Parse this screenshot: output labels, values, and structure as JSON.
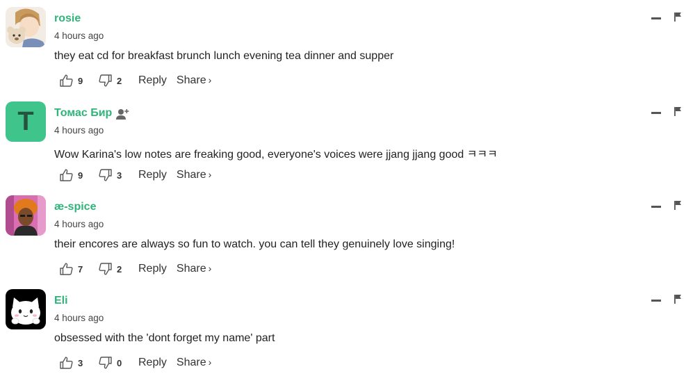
{
  "comments": [
    {
      "username": "rosie",
      "avatar": "anime-boy-with-bear-avatar",
      "time": "4 hours ago",
      "text": "they eat cd for breakfast brunch lunch evening tea dinner and supper",
      "likes": "9",
      "dislikes": "2",
      "reply_label": "Reply",
      "share_label": "Share",
      "share_chevron": "›"
    },
    {
      "username": "Томас Бир",
      "avatar_letter": "T",
      "time": "4 hours ago",
      "text": "Wow Karina's low notes are freaking good, everyone's voices were jjang jjang good ㅋㅋㅋ",
      "likes": "9",
      "dislikes": "3",
      "reply_label": "Reply",
      "share_label": "Share",
      "share_chevron": "›"
    },
    {
      "username": "æ-spice",
      "avatar": "person-orange-hair-avatar",
      "time": "4 hours ago",
      "text": "their encores are always so fun to watch. you can tell they genuinely love singing!",
      "likes": "7",
      "dislikes": "2",
      "reply_label": "Reply",
      "share_label": "Share",
      "share_chevron": "›"
    },
    {
      "username": "Eli",
      "avatar": "white-cat-avatar",
      "time": "4 hours ago",
      "text": "obsessed with the 'dont forget my name' part",
      "likes": "3",
      "dislikes": "0",
      "reply_label": "Reply",
      "share_label": "Share",
      "share_chevron": "›"
    }
  ],
  "colors": {
    "username": "#2fb47a",
    "avatar_t_bg": "#3fc48b",
    "text": "#222222",
    "muted": "#444444"
  }
}
